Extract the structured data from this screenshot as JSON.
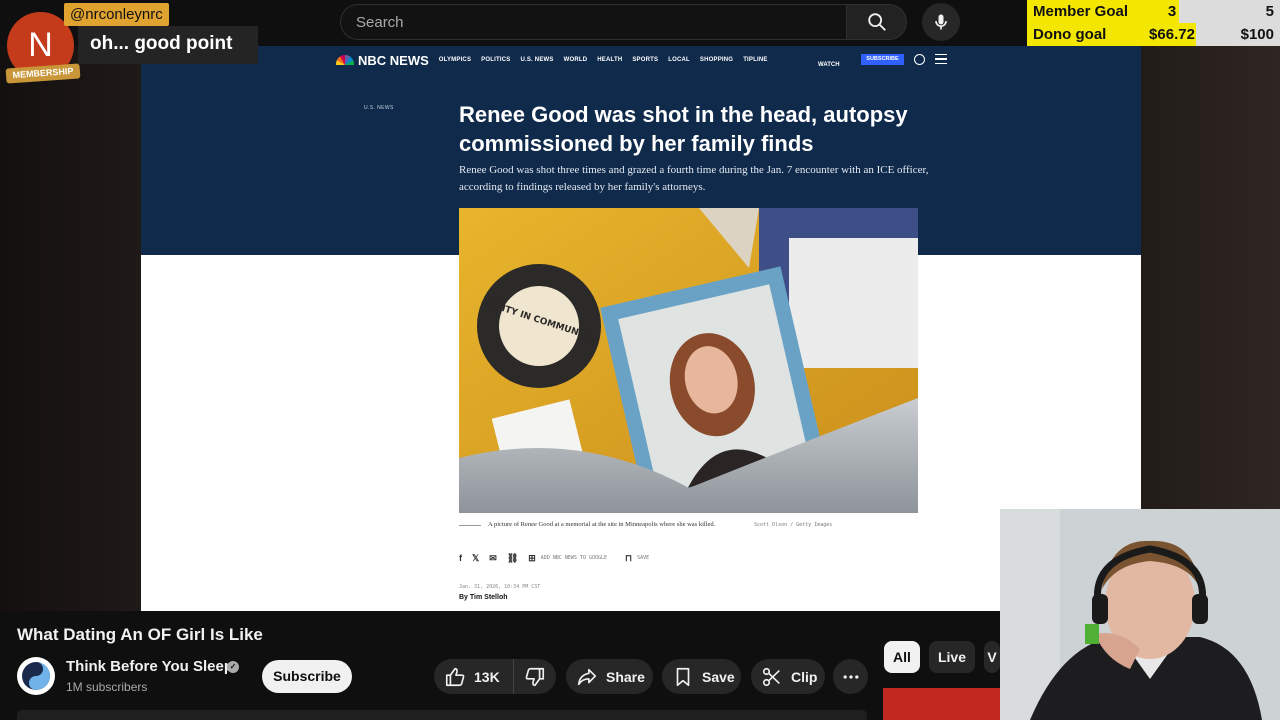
{
  "search": {
    "placeholder": "Search"
  },
  "goals": [
    {
      "label": "Member Goal",
      "current": "3",
      "target": "5",
      "fill_fraction": 0.6
    },
    {
      "label": "Dono goal",
      "current": "$66.72",
      "target": "$100",
      "fill_fraction": 0.6672
    }
  ],
  "chat": {
    "avatar_letter": "N",
    "badge": "MEMBERSHIP",
    "username": "@nrconleynrc",
    "message": "oh... good point"
  },
  "article": {
    "brand": "NBC NEWS",
    "nav": [
      "OLYMPICS",
      "POLITICS",
      "U.S. NEWS",
      "WORLD",
      "HEALTH",
      "SPORTS",
      "LOCAL",
      "SHOPPING",
      "TIPLINE"
    ],
    "watch": "WATCH",
    "subscribe": "SUBSCRIBE",
    "section": "U.S. NEWS",
    "headline": "Renee Good was shot in the head, autopsy commissioned by her family finds",
    "dek": "Renee Good was shot three times and grazed a fourth time during the Jan. 7 encounter with an ICE officer, according to findings released by her family's attorneys.",
    "photo_text": "UNITY IN COMMUNITY",
    "caption": "A picture of Renee Good at a memorial at the site in Minneapolis where she was killed.",
    "credit": "Scott Olson / Getty Images",
    "add_google": "ADD NBC NEWS TO GOOGLE",
    "save": "SAVE",
    "dateline": "Jan. 31, 2026, 10:34 PM CST",
    "byline": "By Tim Stelloh"
  },
  "video": {
    "title": "What Dating An OF Girl Is Like",
    "channel": "Think Before You Sleep",
    "subscribers": "1M subscribers",
    "subscribe_label": "Subscribe",
    "likes": "13K",
    "share_label": "Share",
    "save_label": "Save",
    "clip_label": "Clip"
  },
  "chips": {
    "all": "All",
    "live": "Live",
    "more": "V"
  },
  "icons": [
    "search-icon",
    "mic-icon",
    "like-icon",
    "dislike-icon",
    "share-icon",
    "save-icon",
    "clip-icon",
    "more-icon",
    "verified-icon"
  ],
  "colors": {
    "background": "#0f0f0f",
    "goal_fill": "#f3e600",
    "nbc_navy": "#102a4c",
    "chat_user": "#e0a330"
  }
}
